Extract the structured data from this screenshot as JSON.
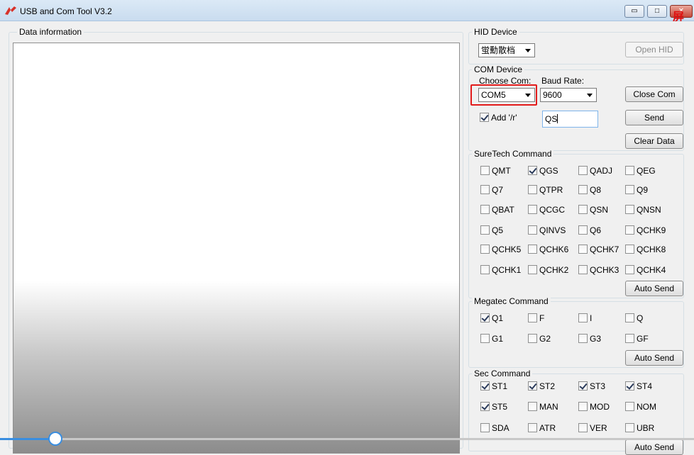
{
  "window": {
    "title": "USB and Com Tool V3.2",
    "overlay_text": "屏幕",
    "controls": {
      "minimize": "▭",
      "maximize": "□",
      "close": "✕"
    }
  },
  "data_info": {
    "label": "Data information"
  },
  "hid": {
    "label": "HID Device",
    "select_value": "蛍勳散档",
    "open_button": "Open HID"
  },
  "com": {
    "label": "COM Device",
    "choose_com_label": "Choose Com:",
    "baud_label": "Baud Rate:",
    "com_value": "COM5",
    "baud_value": "9600",
    "close_button": "Close Com",
    "add_r_label": "Add '/r'",
    "add_r_checked": true,
    "command_value": "QS",
    "send_button": "Send",
    "clear_button": "Clear Data"
  },
  "suretech": {
    "label": "SureTech Command",
    "items": [
      {
        "label": "QMT",
        "checked": false
      },
      {
        "label": "QGS",
        "checked": true
      },
      {
        "label": "QADJ",
        "checked": false
      },
      {
        "label": "QEG",
        "checked": false
      },
      {
        "label": "Q7",
        "checked": false
      },
      {
        "label": "QTPR",
        "checked": false
      },
      {
        "label": "Q8",
        "checked": false
      },
      {
        "label": "Q9",
        "checked": false
      },
      {
        "label": "QBAT",
        "checked": false
      },
      {
        "label": "QCGC",
        "checked": false
      },
      {
        "label": "QSN",
        "checked": false
      },
      {
        "label": "QNSN",
        "checked": false
      },
      {
        "label": "Q5",
        "checked": false
      },
      {
        "label": "QINVS",
        "checked": false
      },
      {
        "label": "Q6",
        "checked": false
      },
      {
        "label": "QCHK9",
        "checked": false
      },
      {
        "label": "QCHK5",
        "checked": false
      },
      {
        "label": "QCHK6",
        "checked": false
      },
      {
        "label": "QCHK7",
        "checked": false
      },
      {
        "label": "QCHK8",
        "checked": false
      },
      {
        "label": "QCHK1",
        "checked": false
      },
      {
        "label": "QCHK2",
        "checked": false
      },
      {
        "label": "QCHK3",
        "checked": false
      },
      {
        "label": "QCHK4",
        "checked": false
      }
    ],
    "auto_send": "Auto Send"
  },
  "megatec": {
    "label": "Megatec Command",
    "items": [
      {
        "label": "Q1",
        "checked": true
      },
      {
        "label": "F",
        "checked": false
      },
      {
        "label": "I",
        "checked": false
      },
      {
        "label": "Q",
        "checked": false
      },
      {
        "label": "G1",
        "checked": false
      },
      {
        "label": "G2",
        "checked": false
      },
      {
        "label": "G3",
        "checked": false
      },
      {
        "label": "GF",
        "checked": false
      }
    ],
    "auto_send": "Auto Send"
  },
  "sec": {
    "label": "Sec Command",
    "items": [
      {
        "label": "ST1",
        "checked": true
      },
      {
        "label": "ST2",
        "checked": true
      },
      {
        "label": "ST3",
        "checked": true
      },
      {
        "label": "ST4",
        "checked": true
      },
      {
        "label": "ST5",
        "checked": true
      },
      {
        "label": "MAN",
        "checked": false
      },
      {
        "label": "MOD",
        "checked": false
      },
      {
        "label": "NOM",
        "checked": false
      },
      {
        "label": "SDA",
        "checked": false
      },
      {
        "label": "ATR",
        "checked": false
      },
      {
        "label": "VER",
        "checked": false
      },
      {
        "label": "UBR",
        "checked": false
      }
    ],
    "auto_send": "Auto Send"
  },
  "slider": {
    "position_fraction": 0.08
  }
}
